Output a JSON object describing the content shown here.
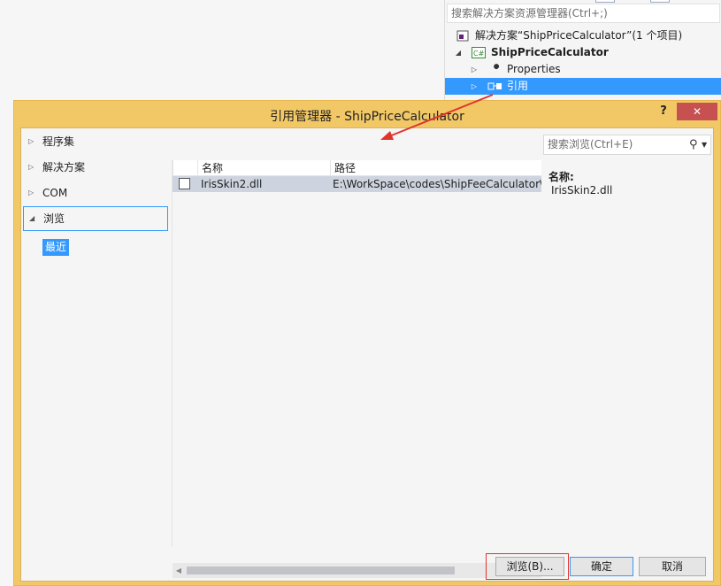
{
  "solution_explorer": {
    "search_placeholder": "搜索解决方案资源管理器(Ctrl+;)",
    "solution": "解决方案“ShipPriceCalculator”(1 个项目)",
    "project": "ShipPriceCalculator",
    "project_badge": "C#",
    "properties": "Properties",
    "references": "引用"
  },
  "dialog": {
    "title": "引用管理器 - ShipPriceCalculator",
    "help": "?",
    "close": "✕",
    "nav": [
      {
        "label": "程序集",
        "expanded": false
      },
      {
        "label": "解决方案",
        "expanded": false
      },
      {
        "label": "COM",
        "expanded": false
      },
      {
        "label": "浏览",
        "expanded": true
      }
    ],
    "nav_sub": "最近",
    "columns": {
      "name": "名称",
      "path": "路径"
    },
    "rows": [
      {
        "name": "IrisSkin2.dll",
        "path": "E:\\WorkSpace\\codes\\ShipFeeCalculator\\",
        "checked": false
      }
    ],
    "search_placeholder": "搜索浏览(Ctrl+E)",
    "details": {
      "label": "名称:",
      "value": "IrisSkin2.dll"
    },
    "buttons": {
      "browse": "浏览(B)...",
      "ok": "确定",
      "cancel": "取消"
    }
  },
  "colors": {
    "title_bar": "#f2c867",
    "selection": "#3399ff",
    "close": "#c75050",
    "annotation": "#e0352b"
  }
}
